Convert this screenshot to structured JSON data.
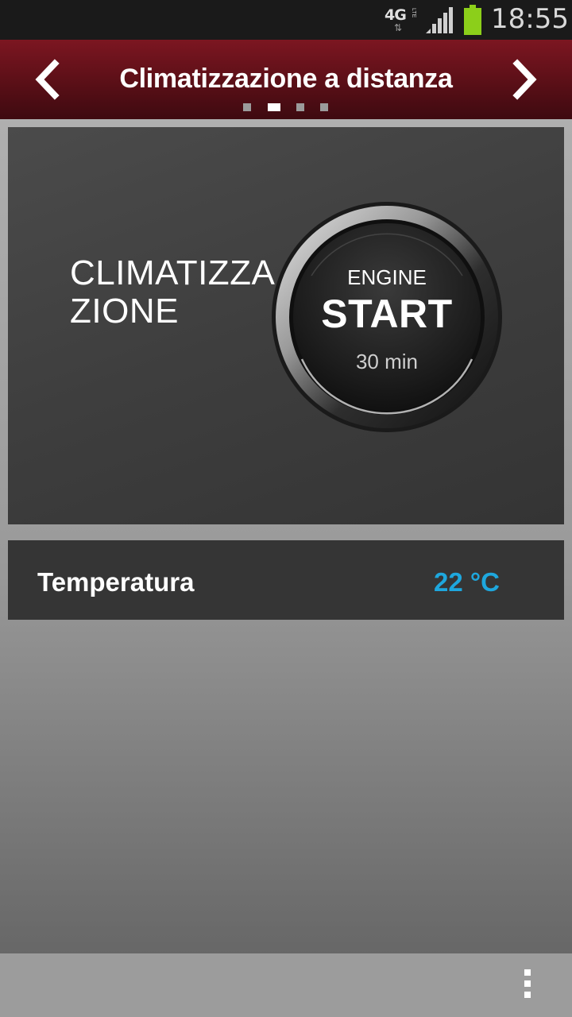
{
  "status_bar": {
    "network": "4G",
    "network_sub": "LTE",
    "signal_icon": "signal-bars-icon",
    "battery_icon": "battery-icon",
    "battery_color": "#8ccf1a",
    "time": "18:55"
  },
  "header": {
    "title": "Climatizzazione a distanza",
    "prev_icon": "chevron-left-icon",
    "next_icon": "chevron-right-icon",
    "page_count": 4,
    "active_page": 2,
    "background": "#6a121b"
  },
  "main": {
    "clima_label": "CLIMATIZZAZIONE",
    "engine_button": {
      "line1": "ENGINE",
      "line2": "START",
      "duration": "30 min"
    }
  },
  "temperature": {
    "label": "Temperatura",
    "value": "22 °C",
    "value_color": "#1ea7dd"
  },
  "bottom_bar": {
    "menu_icon": "overflow-menu-icon"
  }
}
